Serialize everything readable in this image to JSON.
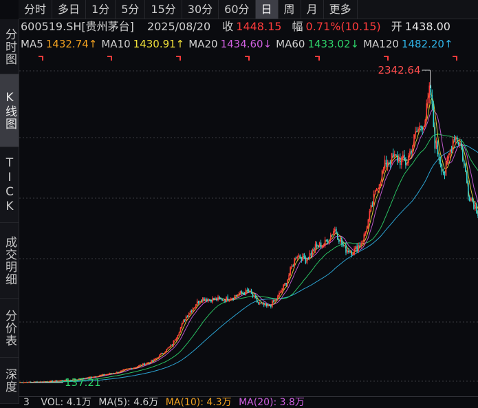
{
  "period_tabs": [
    "分时",
    "多日",
    "1分",
    "5分",
    "15分",
    "30分",
    "60分",
    "日",
    "周",
    "月",
    "更多"
  ],
  "period_active_index": 7,
  "side_tabs": [
    "分时图",
    "K线图",
    "TICK",
    "成交明细",
    "分价表",
    "深度"
  ],
  "side_active_index": 1,
  "quote": {
    "symbol": "600519.SH[贵州茅台]",
    "date": "2025/08/20",
    "close_label": "收",
    "close_value": "1448.15",
    "change_label": "幅",
    "change_value": "0.71%(10.15)",
    "open_label": "开",
    "open_value": "1438.00"
  },
  "ma_legend": [
    {
      "label": "MA5",
      "value": "1432.74↑",
      "color": "#f0a020"
    },
    {
      "label": "MA10",
      "value": "1430.91↑",
      "color": "#f0e03a"
    },
    {
      "label": "MA20",
      "value": "1434.60↓",
      "color": "#d060e0"
    },
    {
      "label": "MA60",
      "value": "1433.02↓",
      "color": "#2ed36a"
    },
    {
      "label": "MA120",
      "value": "1482.20↑",
      "color": "#2fb4e8"
    }
  ],
  "volume": {
    "prefix": "3",
    "vol_label": "VOL: 4.1万",
    "ma5_label": "MA(5): 4.6万",
    "ma10_label": "MA(10): 4.3万",
    "ma20_label": "MA(20): 3.8万",
    "ma5_color": "#cfcfcf",
    "ma10_color": "#f0a020",
    "ma20_color": "#d060e0"
  },
  "chart_data": {
    "type": "line",
    "series": [
      {
        "name": "MA5",
        "color": "#f0a020"
      },
      {
        "name": "MA10",
        "color": "#f0e03a"
      },
      {
        "name": "MA20",
        "color": "#d060e0"
      },
      {
        "name": "MA60",
        "color": "#2ed36a"
      },
      {
        "name": "MA120",
        "color": "#2fb4e8"
      }
    ],
    "price_path": [
      [
        0,
        137.21
      ],
      [
        30,
        145
      ],
      [
        60,
        160
      ],
      [
        80,
        185
      ],
      [
        100,
        210
      ],
      [
        120,
        250
      ],
      [
        140,
        300
      ],
      [
        160,
        420
      ],
      [
        175,
        640
      ],
      [
        190,
        770
      ],
      [
        200,
        760
      ],
      [
        215,
        760
      ],
      [
        230,
        800
      ],
      [
        240,
        820
      ],
      [
        250,
        730
      ],
      [
        260,
        700
      ],
      [
        270,
        770
      ],
      [
        280,
        900
      ],
      [
        290,
        1100
      ],
      [
        300,
        1060
      ],
      [
        310,
        1150
      ],
      [
        320,
        1180
      ],
      [
        330,
        1290
      ],
      [
        340,
        1140
      ],
      [
        350,
        1120
      ],
      [
        360,
        1210
      ],
      [
        375,
        1620
      ],
      [
        385,
        1800
      ],
      [
        395,
        1820
      ],
      [
        405,
        1780
      ],
      [
        415,
        2000
      ],
      [
        425,
        2120
      ],
      [
        430,
        2342.64
      ],
      [
        435,
        1930
      ],
      [
        445,
        1700
      ],
      [
        455,
        2000
      ],
      [
        462,
        1920
      ],
      [
        470,
        1560
      ],
      [
        480,
        1420
      ]
    ],
    "annotations": [
      {
        "text": "2342.64",
        "x": 430,
        "y": 2342.64,
        "color": "#ff4d4d"
      },
      {
        "text": "137.21",
        "x": 0,
        "y": 137.21,
        "color": "#2ed36a"
      }
    ],
    "ylim": [
      80,
      2500
    ],
    "grid": true
  }
}
